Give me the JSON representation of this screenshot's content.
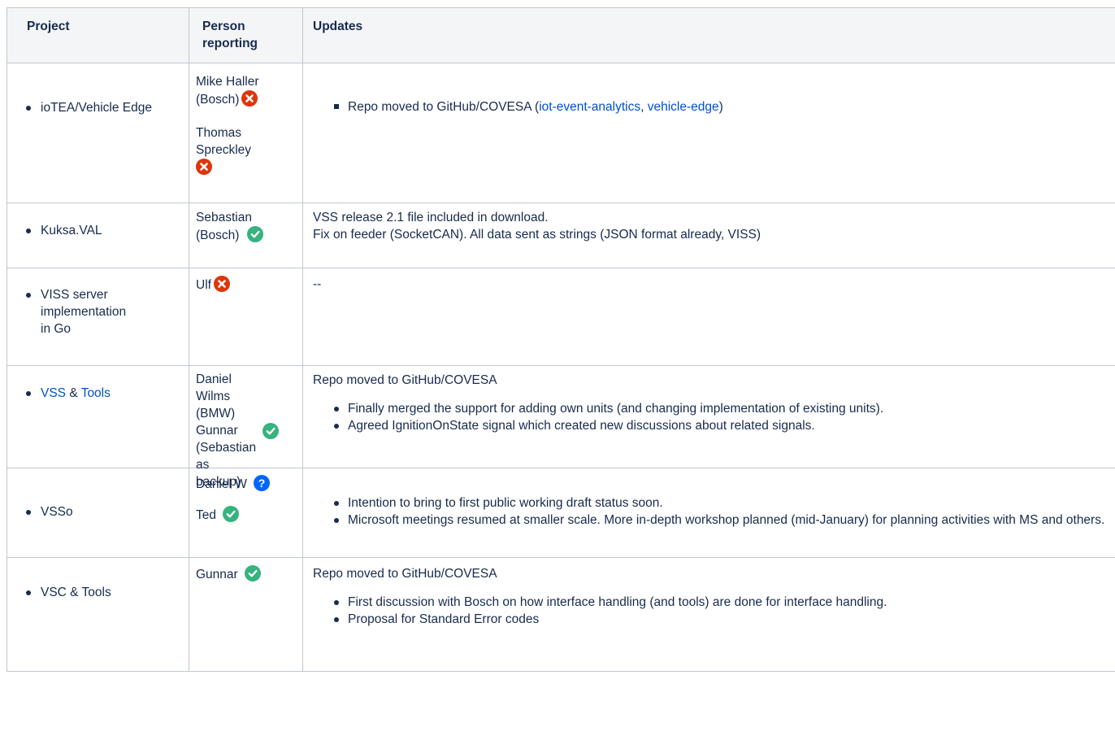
{
  "headers": {
    "project": "Project",
    "person": "Person reporting",
    "updates": "Updates"
  },
  "rows": [
    {
      "project": "ioTEA/Vehicle Edge",
      "persons": [
        {
          "name": "Mike Haller (Bosch)",
          "status": "cross-icon"
        },
        {
          "name": "Thomas Spreckley",
          "status": "cross-icon"
        }
      ],
      "updates": {
        "bullet_text": "Repo moved to GitHub/COVESA  (",
        "link1": "iot-event-analytics",
        "sep": ", ",
        "link2": "vehicle-edge",
        "close": ")"
      }
    },
    {
      "project": "Kuksa.VAL",
      "persons": [
        {
          "name": "Sebastian (Bosch)",
          "status": "check-icon"
        }
      ],
      "updates": {
        "line1": "VSS release 2.1 file included in download.",
        "line2": "Fix on feeder (SocketCAN).  All data sent as strings (JSON format already, VISS)"
      }
    },
    {
      "project": "VISS server implementation in Go",
      "persons": [
        {
          "name": "Ulf",
          "status": "cross-icon"
        }
      ],
      "updates": {
        "line1": "--"
      }
    },
    {
      "project_link1": "VSS",
      "project_mid": " & ",
      "project_link2": "Tools",
      "persons": [
        {
          "name": "Daniel Wilms (BMW) Gunnar (Sebastian as backup)",
          "status": "check-icon"
        }
      ],
      "updates": {
        "intro": "Repo moved to GitHub/COVESA",
        "bullets": [
          "Finally merged the support for adding own units (and changing implementation of existing units).",
          "Agreed IgnitionOnState signal which created new discussions about related signals."
        ]
      }
    },
    {
      "project": "VSSo",
      "persons": [
        {
          "name": "Daniel W",
          "status": "question-icon"
        },
        {
          "name": "Ted",
          "status": "check-icon"
        }
      ],
      "updates": {
        "bullets": [
          "Intention to bring to first public working draft status soon.",
          "Microsoft meetings resumed at smaller scale. More in-depth workshop planned (mid-January) for planning activities with MS and others."
        ]
      }
    },
    {
      "project": "VSC & Tools",
      "persons": [
        {
          "name": "Gunnar",
          "status": "check-icon"
        }
      ],
      "updates": {
        "intro": "Repo moved to GitHub/COVESA",
        "bullets": [
          "First discussion with Bosch on how interface handling (and tools) are done for interface handling.",
          "Proposal for Standard Error codes"
        ]
      }
    }
  ],
  "colors": {
    "check": "#36b37e",
    "cross": "#de350b",
    "question": "#0065ff",
    "link": "#0052cc"
  }
}
